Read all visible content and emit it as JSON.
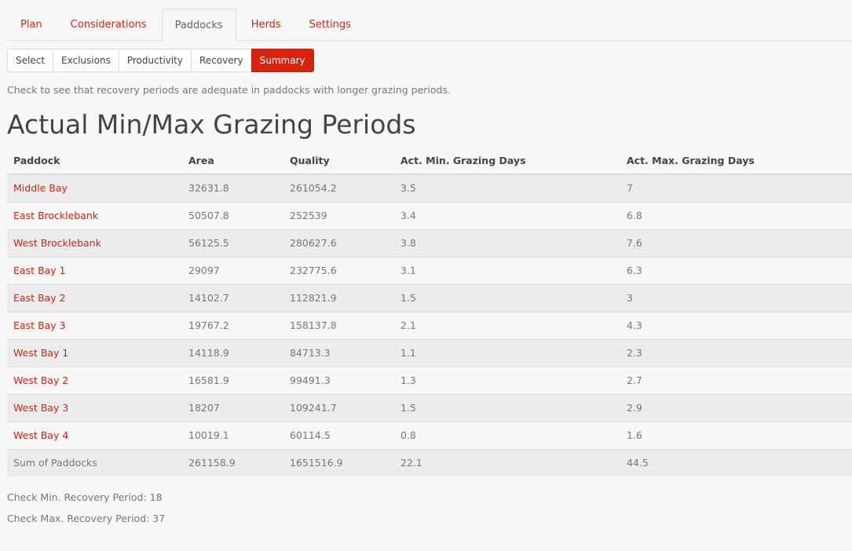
{
  "tabs": [
    {
      "label": "Plan",
      "active": false
    },
    {
      "label": "Considerations",
      "active": false
    },
    {
      "label": "Paddocks",
      "active": true
    },
    {
      "label": "Herds",
      "active": false
    },
    {
      "label": "Settings",
      "active": false
    }
  ],
  "subnav": [
    {
      "label": "Select",
      "active": false
    },
    {
      "label": "Exclusions",
      "active": false
    },
    {
      "label": "Productivity",
      "active": false
    },
    {
      "label": "Recovery",
      "active": false
    },
    {
      "label": "Summary",
      "active": true
    }
  ],
  "hint": "Check to see that recovery periods are adequate in paddocks with longer grazing periods.",
  "title": "Actual Min/Max Grazing Periods",
  "table": {
    "headers": [
      "Paddock",
      "Area",
      "Quality",
      "Act. Min. Grazing Days",
      "Act. Max. Grazing Days"
    ],
    "rows": [
      {
        "name": "Middle Bay",
        "area": "32631.8",
        "quality": "261054.2",
        "min": "3.5",
        "max": "7"
      },
      {
        "name": "East Brocklebank",
        "area": "50507.8",
        "quality": "252539",
        "min": "3.4",
        "max": "6.8"
      },
      {
        "name": "West Brocklebank",
        "area": "56125.5",
        "quality": "280627.6",
        "min": "3.8",
        "max": "7.6"
      },
      {
        "name": "East Bay 1",
        "area": "29097",
        "quality": "232775.6",
        "min": "3.1",
        "max": "6.3"
      },
      {
        "name": "East Bay 2",
        "area": "14102.7",
        "quality": "112821.9",
        "min": "1.5",
        "max": "3"
      },
      {
        "name": "East Bay 3",
        "area": "19767.2",
        "quality": "158137.8",
        "min": "2.1",
        "max": "4.3"
      },
      {
        "name": "West Bay 1",
        "area": "14118.9",
        "quality": "84713.3",
        "min": "1.1",
        "max": "2.3"
      },
      {
        "name": "West Bay 2",
        "area": "16581.9",
        "quality": "99491.3",
        "min": "1.3",
        "max": "2.7"
      },
      {
        "name": "West Bay 3",
        "area": "18207",
        "quality": "109241.7",
        "min": "1.5",
        "max": "2.9"
      },
      {
        "name": "West Bay 4",
        "area": "10019.1",
        "quality": "60114.5",
        "min": "0.8",
        "max": "1.6"
      }
    ],
    "sum": {
      "name": "Sum of Paddocks",
      "area": "261158.9",
      "quality": "1651516.9",
      "min": "22.1",
      "max": "44.5"
    }
  },
  "checks": {
    "min_recovery": "Check Min. Recovery Period: 18",
    "max_recovery": "Check Max. Recovery Period: 37"
  },
  "colors": {
    "accent": "#d9230f",
    "background": "#f7f7f7",
    "stripe": "#ececec"
  }
}
